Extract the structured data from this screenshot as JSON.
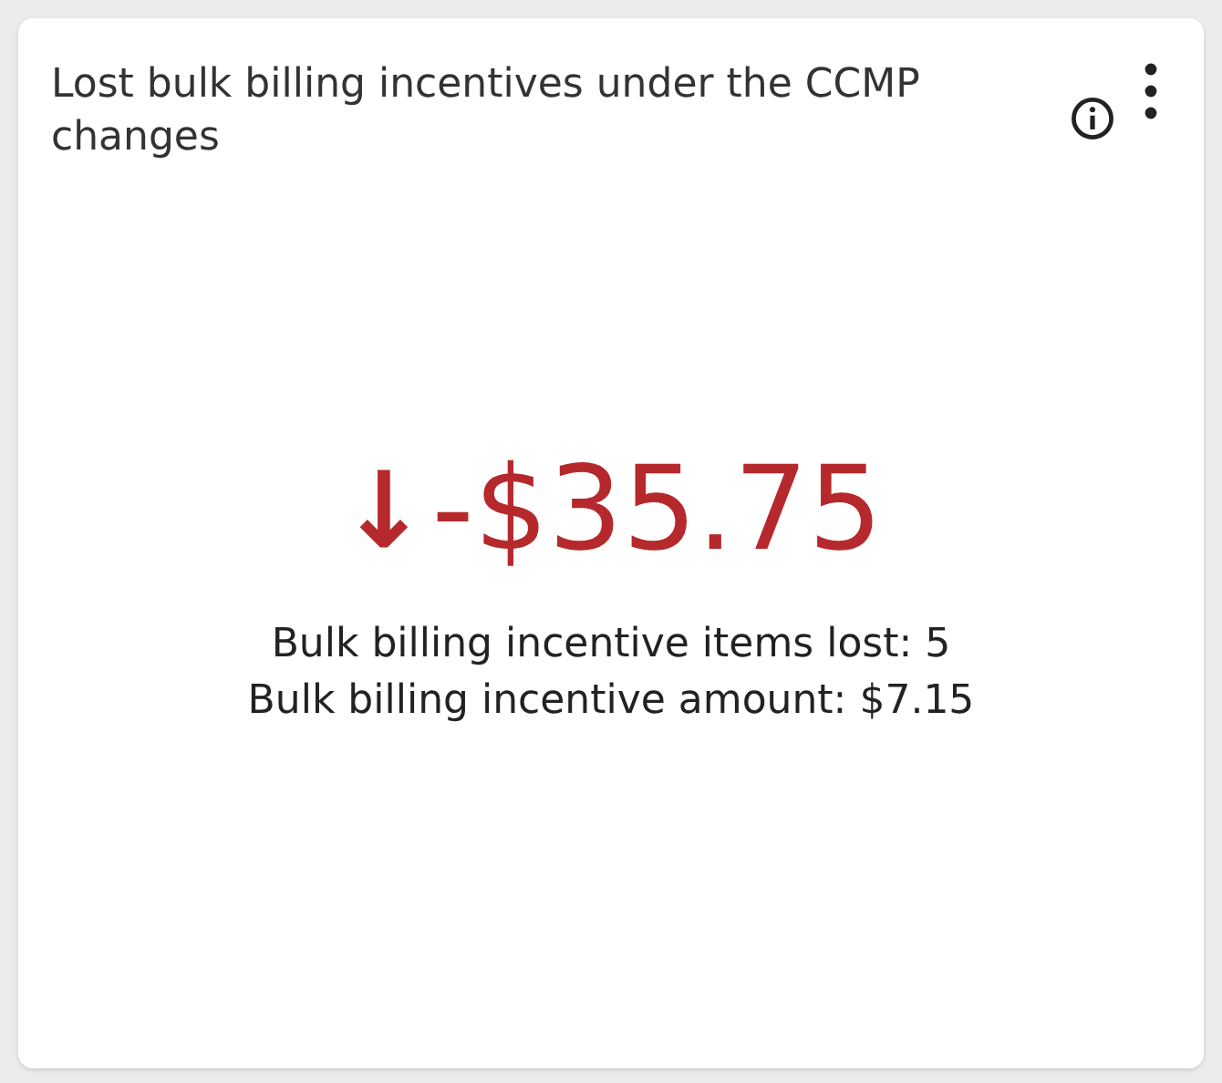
{
  "card": {
    "title": "Lost bulk billing incentives under the CCMP changes",
    "trend_arrow": "↓",
    "value": "-$35.75",
    "details": [
      "Bulk billing incentive items lost: 5",
      "Bulk billing incentive amount: $7.15"
    ]
  }
}
